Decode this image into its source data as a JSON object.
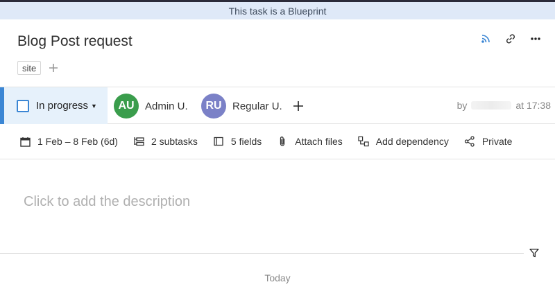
{
  "banner": {
    "text": "This task is a Blueprint"
  },
  "task": {
    "title": "Blog Post request",
    "tags": [
      "site"
    ]
  },
  "header_icons": [
    "rss-icon",
    "link-icon",
    "more-icon"
  ],
  "status": {
    "label": "In progress"
  },
  "assignees": [
    {
      "initials": "AU",
      "name": "Admin U.",
      "color": "#3a9d4c"
    },
    {
      "initials": "RU",
      "name": "Regular U.",
      "color": "#7b81c7"
    }
  ],
  "byline": {
    "prefix": "by",
    "time": "at 17:38"
  },
  "meta": {
    "dates": "1 Feb – 8 Feb (6d)",
    "subtasks": "2 subtasks",
    "fields": "5 fields",
    "attach": "Attach files",
    "dependency": "Add dependency",
    "privacy": "Private"
  },
  "description": {
    "placeholder": "Click to add the description"
  },
  "activity": {
    "day_label": "Today"
  },
  "colors": {
    "accent": "#3b86d4",
    "banner_bg": "#dfe9f8",
    "status_bg": "#e6f1fb"
  }
}
